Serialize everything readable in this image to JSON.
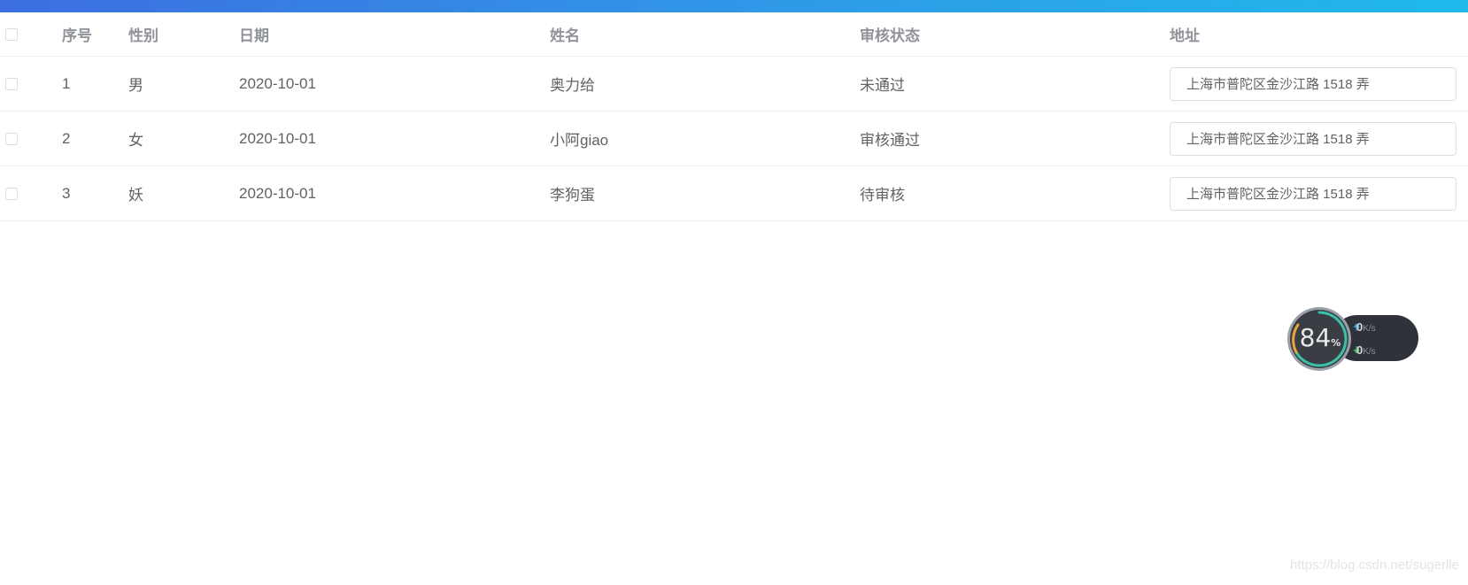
{
  "table": {
    "headers": {
      "index": "序号",
      "gender": "性别",
      "date": "日期",
      "name": "姓名",
      "status": "审核状态",
      "address": "地址"
    },
    "rows": [
      {
        "index": "1",
        "gender": "男",
        "date": "2020-10-01",
        "name": "奥力给",
        "status": "未通过",
        "address": "上海市普陀区金沙江路 1518 弄"
      },
      {
        "index": "2",
        "gender": "女",
        "date": "2020-10-01",
        "name": "小阿giao",
        "status": "审核通过",
        "address": "上海市普陀区金沙江路 1518 弄"
      },
      {
        "index": "3",
        "gender": "妖",
        "date": "2020-10-01",
        "name": "李狗蛋",
        "status": "待审核",
        "address": "上海市普陀区金沙江路 1518 弄"
      }
    ]
  },
  "speed_widget": {
    "percent": "84",
    "percent_unit": "%",
    "upload_value": "0",
    "download_value": "0",
    "rate_unit": "K/s"
  },
  "watermark": "https://blog.csdn.net/sugerlle",
  "colors": {
    "topbar_start": "#3c6ee0",
    "topbar_end": "#1fb9ea",
    "border": "#ebeef5"
  }
}
